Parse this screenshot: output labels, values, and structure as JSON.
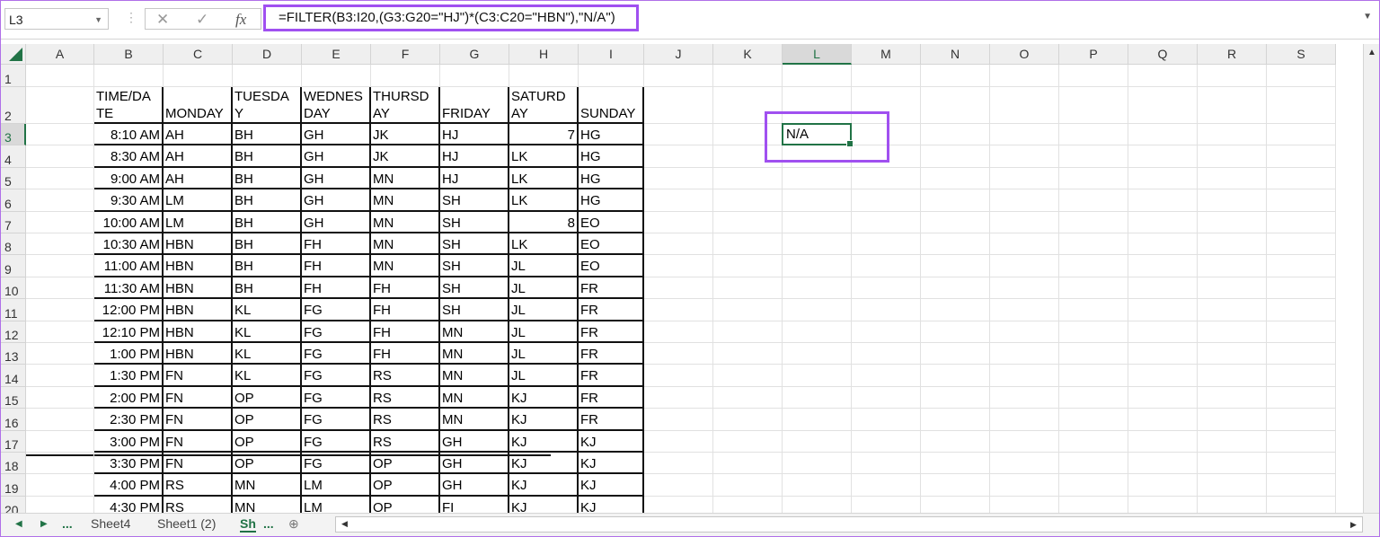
{
  "name_box": "L3",
  "formula": "=FILTER(B3:I20,(G3:G20=\"HJ\")*(C3:C20=\"HBN\"),\"N/A\")",
  "icons": {
    "cancel": "✕",
    "enter": "✓",
    "fx": "fx"
  },
  "columns": [
    "A",
    "B",
    "C",
    "D",
    "E",
    "F",
    "G",
    "H",
    "I",
    "J",
    "K",
    "L",
    "M",
    "N",
    "O",
    "P",
    "Q",
    "R",
    "S"
  ],
  "rows": [
    "1",
    "2",
    "3",
    "4",
    "5",
    "6",
    "7",
    "8",
    "9",
    "10",
    "11",
    "12",
    "13",
    "14",
    "15",
    "16",
    "17",
    "18",
    "19",
    "20"
  ],
  "table_headers": [
    "TIME/DA\nTE",
    "MONDAY",
    "TUESDA\nY",
    "WEDNES\nDAY",
    "THURSD\nAY",
    "FRIDAY",
    "SATURD\nAY",
    "SUNDAY"
  ],
  "table_rows": [
    [
      "8:10 AM",
      "AH",
      "BH",
      "GH",
      "JK",
      "HJ",
      "7",
      "HG"
    ],
    [
      "8:30 AM",
      "AH",
      "BH",
      "GH",
      "JK",
      "HJ",
      "LK",
      "HG"
    ],
    [
      "9:00 AM",
      "AH",
      "BH",
      "GH",
      "MN",
      "HJ",
      "LK",
      "HG"
    ],
    [
      "9:30 AM",
      "LM",
      "BH",
      "GH",
      "MN",
      "SH",
      "LK",
      "HG"
    ],
    [
      "10:00 AM",
      "LM",
      "BH",
      "GH",
      "MN",
      "SH",
      "8",
      "EO"
    ],
    [
      "10:30 AM",
      "HBN",
      "BH",
      "FH",
      "MN",
      "SH",
      "LK",
      "EO"
    ],
    [
      "11:00 AM",
      "HBN",
      "BH",
      "FH",
      "MN",
      "SH",
      "JL",
      "EO"
    ],
    [
      "11:30 AM",
      "HBN",
      "BH",
      "FH",
      "FH",
      "SH",
      "JL",
      "FR"
    ],
    [
      "12:00 PM",
      "HBN",
      "KL",
      "FG",
      "FH",
      "SH",
      "JL",
      "FR"
    ],
    [
      "12:10 PM",
      "HBN",
      "KL",
      "FG",
      "FH",
      "MN",
      "JL",
      "FR"
    ],
    [
      "1:00 PM",
      "HBN",
      "KL",
      "FG",
      "FH",
      "MN",
      "JL",
      "FR"
    ],
    [
      "1:30 PM",
      "FN",
      "KL",
      "FG",
      "RS",
      "MN",
      "JL",
      "FR"
    ],
    [
      "2:00 PM",
      "FN",
      "OP",
      "FG",
      "RS",
      "MN",
      "KJ",
      "FR"
    ],
    [
      "2:30 PM",
      "FN",
      "OP",
      "FG",
      "RS",
      "MN",
      "KJ",
      "FR"
    ],
    [
      "3:00 PM",
      "FN",
      "OP",
      "FG",
      "RS",
      "GH",
      "KJ",
      "KJ"
    ],
    [
      "3:30 PM",
      "FN",
      "OP",
      "FG",
      "OP",
      "GH",
      "KJ",
      "KJ"
    ],
    [
      "4:00 PM",
      "RS",
      "MN",
      "LM",
      "OP",
      "GH",
      "KJ",
      "KJ"
    ],
    [
      "4:30 PM",
      "RS",
      "MN",
      "LM",
      "OP",
      "FI",
      "KJ",
      "KJ"
    ]
  ],
  "result_cell": "N/A",
  "sheet_tabs": {
    "more": "...",
    "tab1": "Sheet4",
    "tab2": "Sheet1 (2)",
    "active": "Sh",
    "more2": "..."
  },
  "accent": "#217346",
  "highlight": "#a050f0"
}
